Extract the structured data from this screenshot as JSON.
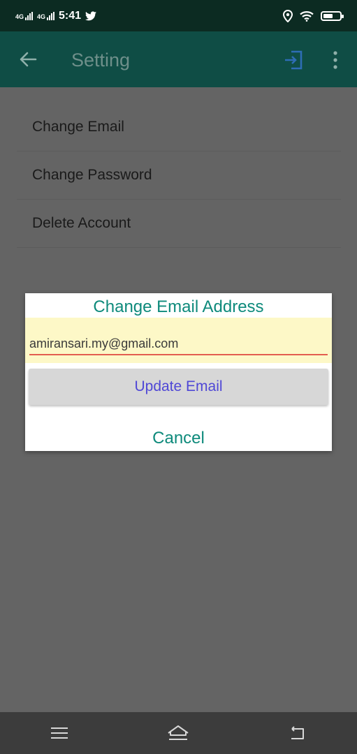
{
  "status_bar": {
    "network_1": "4G",
    "network_2": "4G",
    "time": "5:41",
    "icons": [
      "signal-icon",
      "twitter-icon",
      "location-icon",
      "wifi-icon",
      "battery-icon"
    ],
    "battery_level": 0.6
  },
  "app_bar": {
    "title": "Setting",
    "icons": [
      "back-arrow-icon",
      "exit-icon",
      "more-vert-icon"
    ]
  },
  "menu": {
    "items": [
      {
        "label": "Change Email"
      },
      {
        "label": "Change Password"
      },
      {
        "label": "Delete Account"
      }
    ]
  },
  "dialog": {
    "title": "Change Email Address",
    "email_value": "amiransari.my@gmail.com",
    "update_label": "Update Email",
    "cancel_label": "Cancel"
  },
  "nav_bar": {
    "icons": [
      "menu-icon",
      "home-icon",
      "back-icon"
    ]
  },
  "colors": {
    "status_bar": "#0c2b22",
    "app_bar": "#0f4d45",
    "accent_teal": "#0e8a7b",
    "button_text": "#4f47d6",
    "input_underline": "#e35d4f",
    "input_bg": "#fdf8c7",
    "scrim": "#646464"
  }
}
